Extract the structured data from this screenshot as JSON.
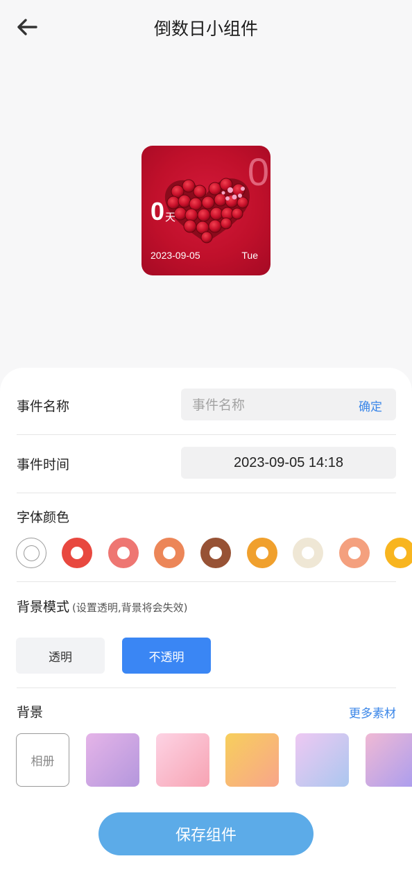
{
  "header": {
    "title": "倒数日小组件",
    "back_icon": "arrow-left-icon"
  },
  "widget": {
    "big_number": "0",
    "count": "0",
    "unit": "天",
    "date": "2023-09-05",
    "weekday": "Tue",
    "background": "rose-heart-photo"
  },
  "event_name": {
    "label": "事件名称",
    "placeholder": "事件名称",
    "value": "",
    "confirm": "确定"
  },
  "event_time": {
    "label": "事件时间",
    "value": "2023-09-05 14:18"
  },
  "font_color": {
    "label": "字体颜色",
    "colors": [
      "#ffffff",
      "#e8483f",
      "#ee7672",
      "#ec8658",
      "#975235",
      "#f0a02d",
      "#efe7d5",
      "#f4a07e",
      "#f8b51f"
    ]
  },
  "bg_mode": {
    "label": "背景模式",
    "hint": "(设置透明,背景将会失效)",
    "transparent": "透明",
    "opaque": "不透明",
    "selected": "不透明"
  },
  "background": {
    "label": "背景",
    "more": "更多素材",
    "album": "相册",
    "gradients": [
      [
        "#e5b4e8",
        "#b497dd"
      ],
      [
        "#fdd3e4",
        "#f7a3b3"
      ],
      [
        "#f7cf5c",
        "#f8a58a"
      ],
      [
        "#eec8f2",
        "#abc7ef"
      ],
      [
        "#f0b9d4",
        "#a89cef"
      ]
    ]
  },
  "save_button": "保存组件",
  "colors": {
    "accent": "#3a86f4",
    "link": "#3a86e8",
    "save": "#5cabe8"
  }
}
